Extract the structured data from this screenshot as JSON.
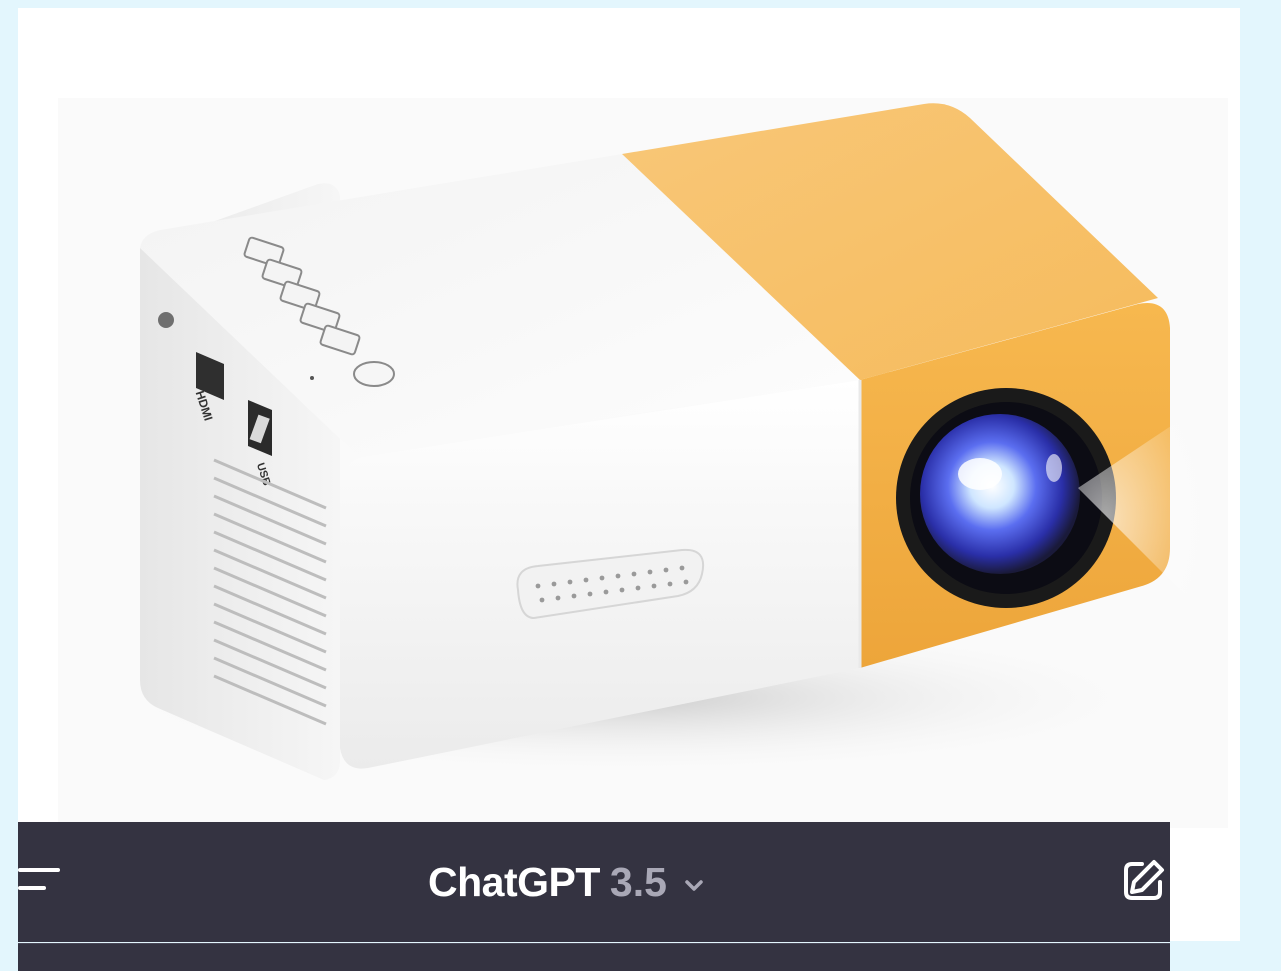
{
  "photo": {
    "subject": "mini projector",
    "port_labels": [
      "HDMI",
      "USB"
    ],
    "colors": {
      "body": "#ffffff",
      "accent": "#f7b94c",
      "lens": "#3a46d8"
    }
  },
  "header": {
    "menu_icon": "hamburger-menu-icon",
    "title": "ChatGPT",
    "version": "3.5",
    "chevron_icon": "chevron-down-icon",
    "new_chat_icon": "edit-icon",
    "colors": {
      "background": "#343341",
      "title": "#ffffff",
      "version": "#a9a8b6"
    }
  }
}
